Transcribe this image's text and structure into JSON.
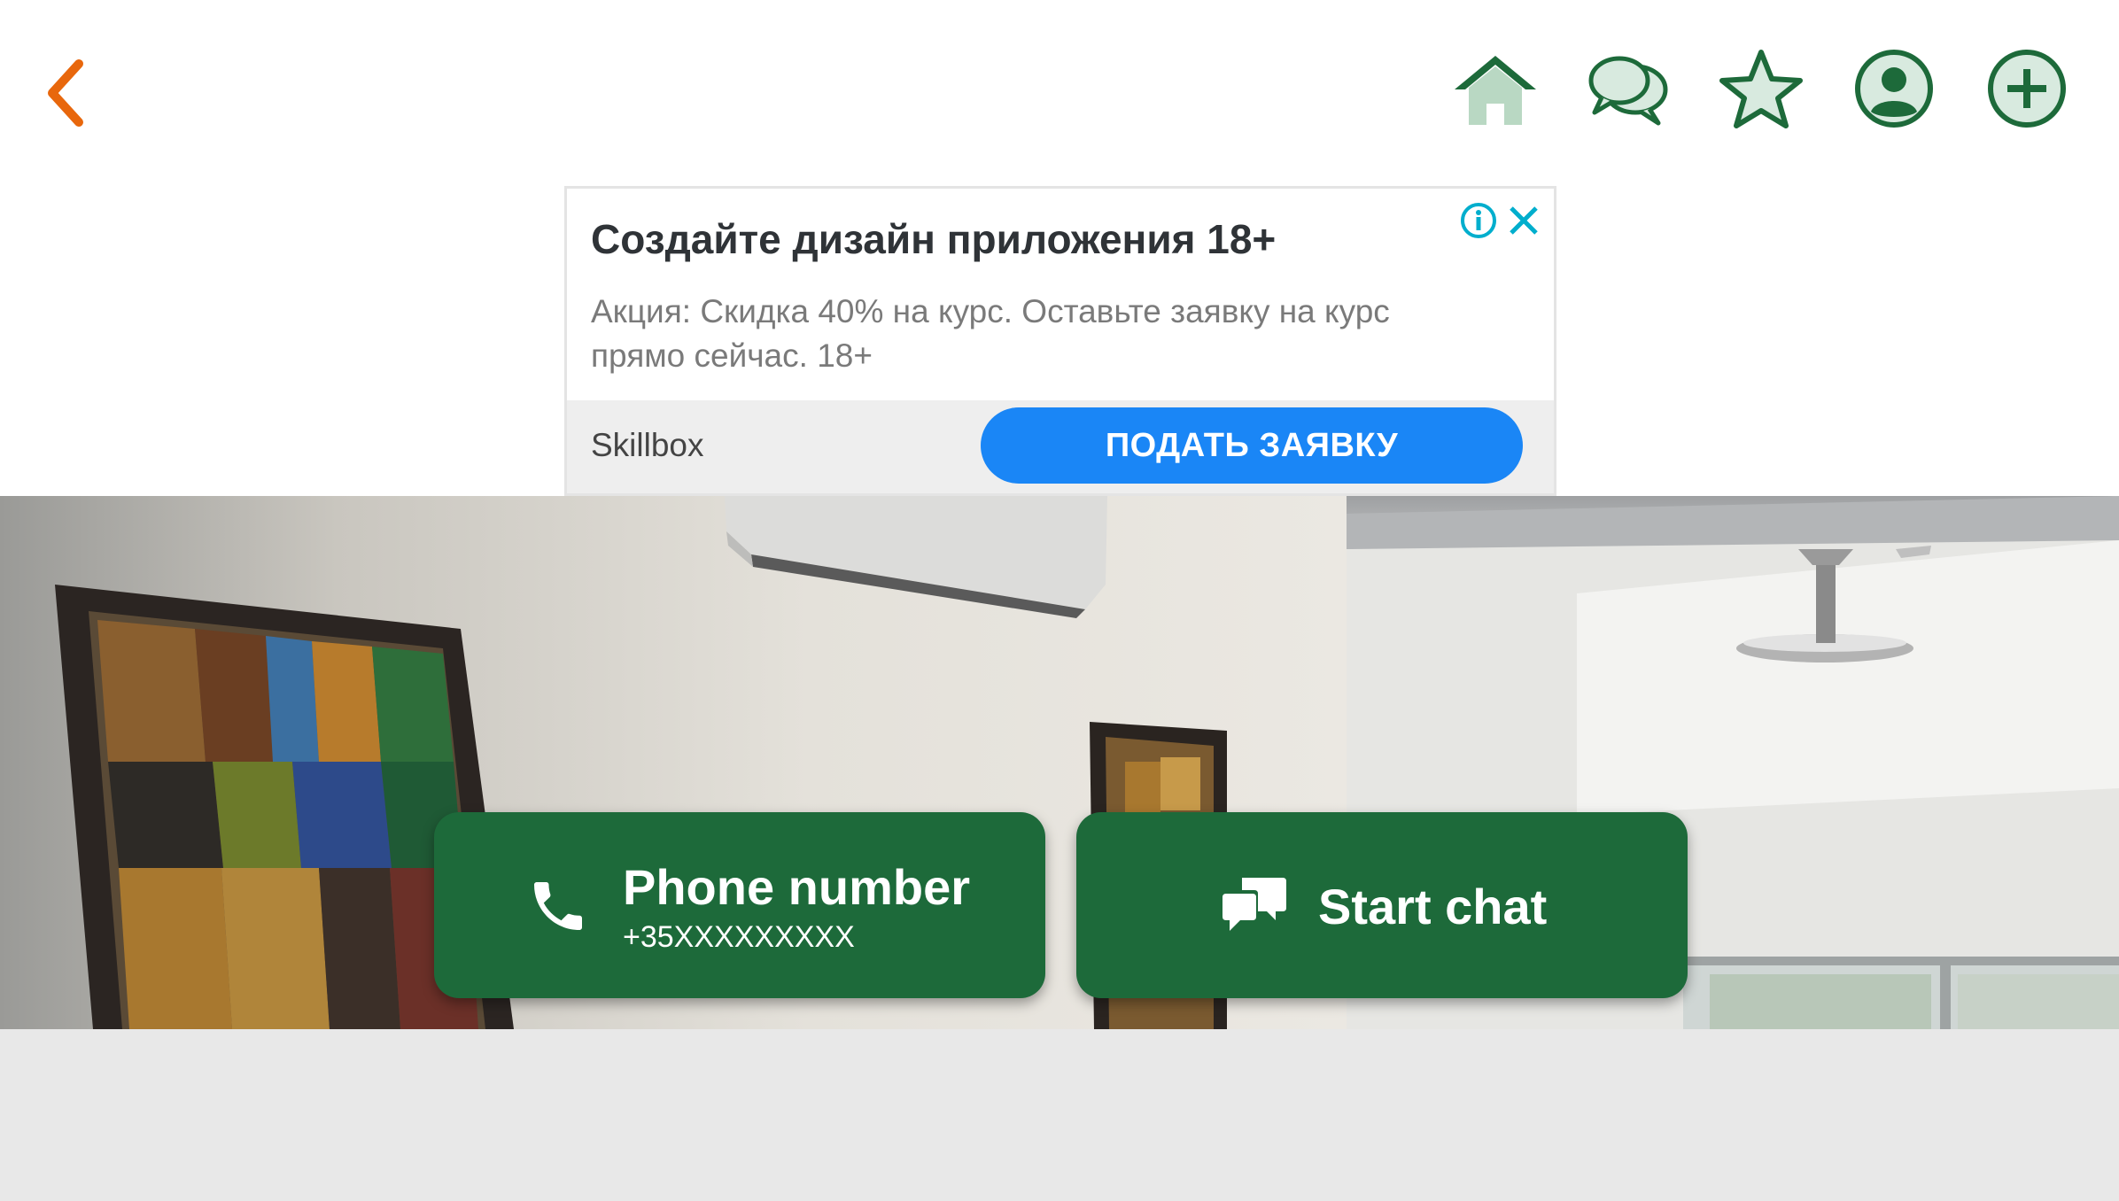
{
  "header": {
    "back_icon": "chevron-left-icon",
    "nav_icons": [
      "home-icon",
      "chat-bubbles-icon",
      "star-icon",
      "account-icon",
      "add-circle-icon"
    ],
    "accent_color": "#1d6a3a",
    "back_color": "#e8670c"
  },
  "ad": {
    "title": "Создайте дизайн приложения 18+",
    "description": "Акция: Скидка 40% на курс. Оставьте заявку на курс прямо сейчас. 18+",
    "brand": "Skillbox",
    "cta_label": "ПОДАТЬ ЗАЯВКУ",
    "cta_color": "#1a86f6"
  },
  "actions": {
    "phone_title": "Phone number",
    "phone_number": "+35XXXXXXXXX",
    "chat_label": "Start chat",
    "button_color": "#1d6a3a"
  }
}
